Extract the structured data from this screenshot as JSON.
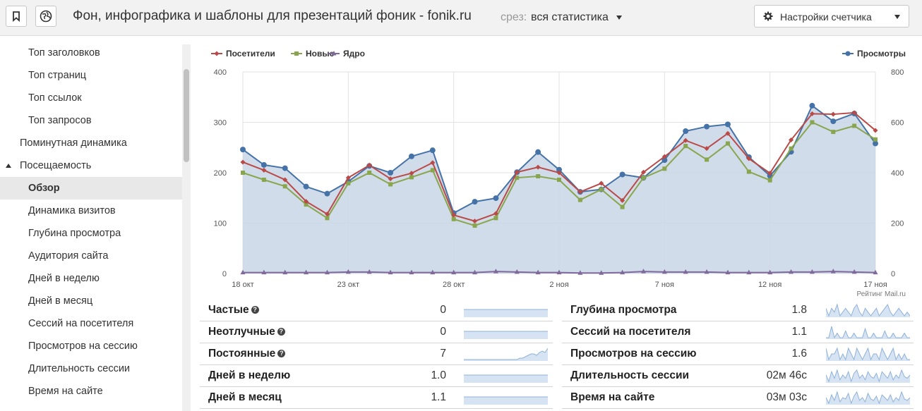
{
  "header": {
    "title": "Фон, инфографика и шаблоны для презентаций фоник - fonik.ru",
    "slice_label": "срез:",
    "slice_value": "вся статистика",
    "settings_label": "Настройки счетчика"
  },
  "sidebar": {
    "items": [
      {
        "label": "Топ заголовков",
        "indent": 2
      },
      {
        "label": "Топ страниц",
        "indent": 2
      },
      {
        "label": "Топ ссылок",
        "indent": 2
      },
      {
        "label": "Топ запросов",
        "indent": 2
      },
      {
        "label": "Поминутная динамика",
        "indent": 1
      },
      {
        "label": "Посещаемость",
        "indent": 1,
        "expanded": true
      },
      {
        "label": "Обзор",
        "indent": 2,
        "active": true
      },
      {
        "label": "Динамика визитов",
        "indent": 2
      },
      {
        "label": "Глубина просмотра",
        "indent": 2
      },
      {
        "label": "Аудитория сайта",
        "indent": 2
      },
      {
        "label": "Дней в неделю",
        "indent": 2
      },
      {
        "label": "Дней в месяц",
        "indent": 2
      },
      {
        "label": "Сессий на посетителя",
        "indent": 2
      },
      {
        "label": "Просмотров на сессию",
        "indent": 2
      },
      {
        "label": "Длительность сессии",
        "indent": 2
      },
      {
        "label": "Время на сайте",
        "indent": 2
      }
    ]
  },
  "chart_data": {
    "type": "line",
    "x": [
      "18 окт",
      "19 окт",
      "20 окт",
      "21 окт",
      "22 окт",
      "23 окт",
      "24 окт",
      "25 окт",
      "26 окт",
      "27 окт",
      "28 окт",
      "29 окт",
      "30 окт",
      "31 окт",
      "1 ноя",
      "2 ноя",
      "3 ноя",
      "4 ноя",
      "5 ноя",
      "6 ноя",
      "7 ноя",
      "8 ноя",
      "9 ноя",
      "10 ноя",
      "11 ноя",
      "12 ноя",
      "13 ноя",
      "14 ноя",
      "15 ноя",
      "16 ноя",
      "17 ноя"
    ],
    "x_tick_labels": [
      "18 окт",
      "23 окт",
      "28 окт",
      "2 ноя",
      "7 ноя",
      "12 ноя",
      "17 ноя"
    ],
    "x_tick_indices": [
      0,
      5,
      10,
      15,
      20,
      25,
      30
    ],
    "y_left_ticks": [
      0,
      100,
      200,
      300,
      400
    ],
    "y_right_ticks": [
      0,
      200,
      400,
      600,
      800
    ],
    "ylim_left": [
      0,
      400
    ],
    "ylim_right": [
      0,
      800
    ],
    "grid": true,
    "legend_left": "top-left",
    "legend_right": "top-right",
    "watermark": "Рейтинг Mail.ru",
    "series": [
      {
        "name": "Посетители",
        "color": "#b94a48",
        "marker": "diamond",
        "axis": "left",
        "values": [
          221,
          205,
          186,
          143,
          118,
          190,
          215,
          188,
          199,
          220,
          116,
          104,
          119,
          201,
          211,
          200,
          162,
          179,
          145,
          201,
          232,
          264,
          248,
          278,
          228,
          199,
          265,
          317,
          316,
          319,
          284
        ]
      },
      {
        "name": "Новые",
        "color": "#89a54e",
        "marker": "square",
        "axis": "left",
        "values": [
          200,
          186,
          173,
          137,
          110,
          179,
          200,
          177,
          191,
          205,
          108,
          95,
          110,
          190,
          193,
          186,
          146,
          167,
          132,
          190,
          208,
          253,
          226,
          258,
          202,
          185,
          248,
          300,
          281,
          293,
          266
        ]
      },
      {
        "name": "Ядро",
        "color": "#80699b",
        "marker": "triangle",
        "axis": "left",
        "values": [
          2,
          2,
          2,
          2,
          2,
          3,
          3,
          2,
          2,
          2,
          2,
          2,
          4,
          3,
          2,
          2,
          1,
          1,
          2,
          4,
          3,
          3,
          3,
          2,
          2,
          2,
          3,
          3,
          4,
          3,
          2
        ]
      },
      {
        "name": "Просмотры",
        "color": "#4572a7",
        "marker": "circle",
        "axis": "right",
        "area": true,
        "values": [
          492,
          431,
          418,
          345,
          317,
          365,
          427,
          400,
          465,
          489,
          240,
          285,
          299,
          402,
          482,
          412,
          324,
          334,
          393,
          380,
          450,
          565,
          583,
          592,
          462,
          388,
          483,
          666,
          604,
          635,
          516
        ]
      }
    ]
  },
  "stats_left": [
    {
      "name": "Частые",
      "help": true,
      "value": "0",
      "spark": [
        0,
        0,
        0,
        0,
        0,
        0,
        0,
        0,
        0,
        0,
        0,
        0,
        0,
        0,
        0,
        0,
        0,
        0,
        0,
        0,
        0,
        0,
        0,
        0,
        0,
        0,
        0,
        0,
        0,
        0,
        0
      ]
    },
    {
      "name": "Неотлучные",
      "help": true,
      "value": "0",
      "spark": [
        0,
        0,
        0,
        0,
        0,
        0,
        0,
        0,
        0,
        0,
        0,
        0,
        0,
        0,
        0,
        0,
        0,
        0,
        0,
        0,
        0,
        0,
        0,
        0,
        0,
        0,
        0,
        0,
        0,
        0,
        0
      ]
    },
    {
      "name": "Постоянные",
      "help": true,
      "value": "7",
      "spark": [
        0,
        0,
        0,
        0,
        0,
        0,
        0,
        0,
        0,
        0,
        0,
        0,
        0,
        0,
        0,
        0,
        0,
        0,
        0,
        0,
        1,
        1,
        2,
        3,
        4,
        4,
        3,
        5,
        6,
        5,
        8
      ]
    },
    {
      "name": "Дней в неделю",
      "help": false,
      "value": "1.0",
      "spark": [
        1,
        1,
        1,
        1,
        1,
        1,
        1,
        1,
        1,
        1,
        1,
        1,
        1,
        1,
        1,
        1,
        1,
        1,
        1,
        1,
        1,
        1,
        1,
        1,
        1,
        1,
        1,
        1,
        1,
        1,
        1
      ]
    },
    {
      "name": "Дней в месяц",
      "help": false,
      "value": "1.1",
      "spark": [
        1.1,
        1.1,
        1.1,
        1.1,
        1.1,
        1.1,
        1.1,
        1.1,
        1.1,
        1.1,
        1.1,
        1.1,
        1.1,
        1.1,
        1.1,
        1.1,
        1.1,
        1.1,
        1.1,
        1.1,
        1.1,
        1.1,
        1.1,
        1.1,
        1.1,
        1.1,
        1.1,
        1.1,
        1.1,
        1.1,
        1.1
      ]
    }
  ],
  "stats_right": [
    {
      "name": "Глубина просмотра",
      "value": "1.8",
      "spark": [
        2.0,
        1.8,
        2.0,
        1.9,
        2.1,
        1.8,
        1.9,
        2.0,
        1.9,
        1.8,
        2.0,
        2.1,
        1.9,
        1.8,
        2.0,
        1.9,
        1.8,
        1.9,
        2.0,
        1.8,
        1.9,
        2.0,
        2.1,
        1.9,
        1.8,
        1.9,
        2.0,
        1.9,
        1.8,
        1.9,
        1.8
      ]
    },
    {
      "name": "Сессий на посетителя",
      "value": "1.1",
      "spark": [
        1.1,
        1.1,
        1.15,
        1.1,
        1.12,
        1.1,
        1.1,
        1.13,
        1.1,
        1.1,
        1.12,
        1.1,
        1.1,
        1.1,
        1.14,
        1.1,
        1.1,
        1.12,
        1.1,
        1.1,
        1.1,
        1.13,
        1.1,
        1.1,
        1.12,
        1.1,
        1.1,
        1.1,
        1.12,
        1.1,
        1.1
      ]
    },
    {
      "name": "Просмотров на сессию",
      "value": "1.6",
      "spark": [
        1.8,
        1.6,
        1.7,
        1.7,
        1.8,
        1.6,
        1.7,
        1.6,
        1.8,
        1.7,
        1.6,
        1.8,
        1.7,
        1.6,
        1.7,
        1.8,
        1.6,
        1.7,
        1.7,
        1.6,
        1.8,
        1.7,
        1.6,
        1.7,
        1.8,
        1.6,
        1.7,
        1.6,
        1.7,
        1.6,
        1.6
      ]
    },
    {
      "name": "Длительность сессии",
      "value": "02м 46с",
      "spark": [
        160,
        140,
        170,
        150,
        175,
        145,
        160,
        150,
        170,
        140,
        165,
        175,
        150,
        160,
        145,
        170,
        155,
        150,
        165,
        140,
        170,
        160,
        150,
        170,
        145,
        160,
        150,
        175,
        155,
        150,
        160
      ]
    },
    {
      "name": "Время на сайте",
      "value": "03м 03с",
      "spark": [
        180,
        160,
        190,
        170,
        200,
        165,
        180,
        175,
        195,
        160,
        185,
        200,
        170,
        180,
        165,
        195,
        175,
        170,
        185,
        160,
        190,
        180,
        170,
        190,
        165,
        180,
        170,
        200,
        175,
        170,
        180
      ]
    }
  ]
}
